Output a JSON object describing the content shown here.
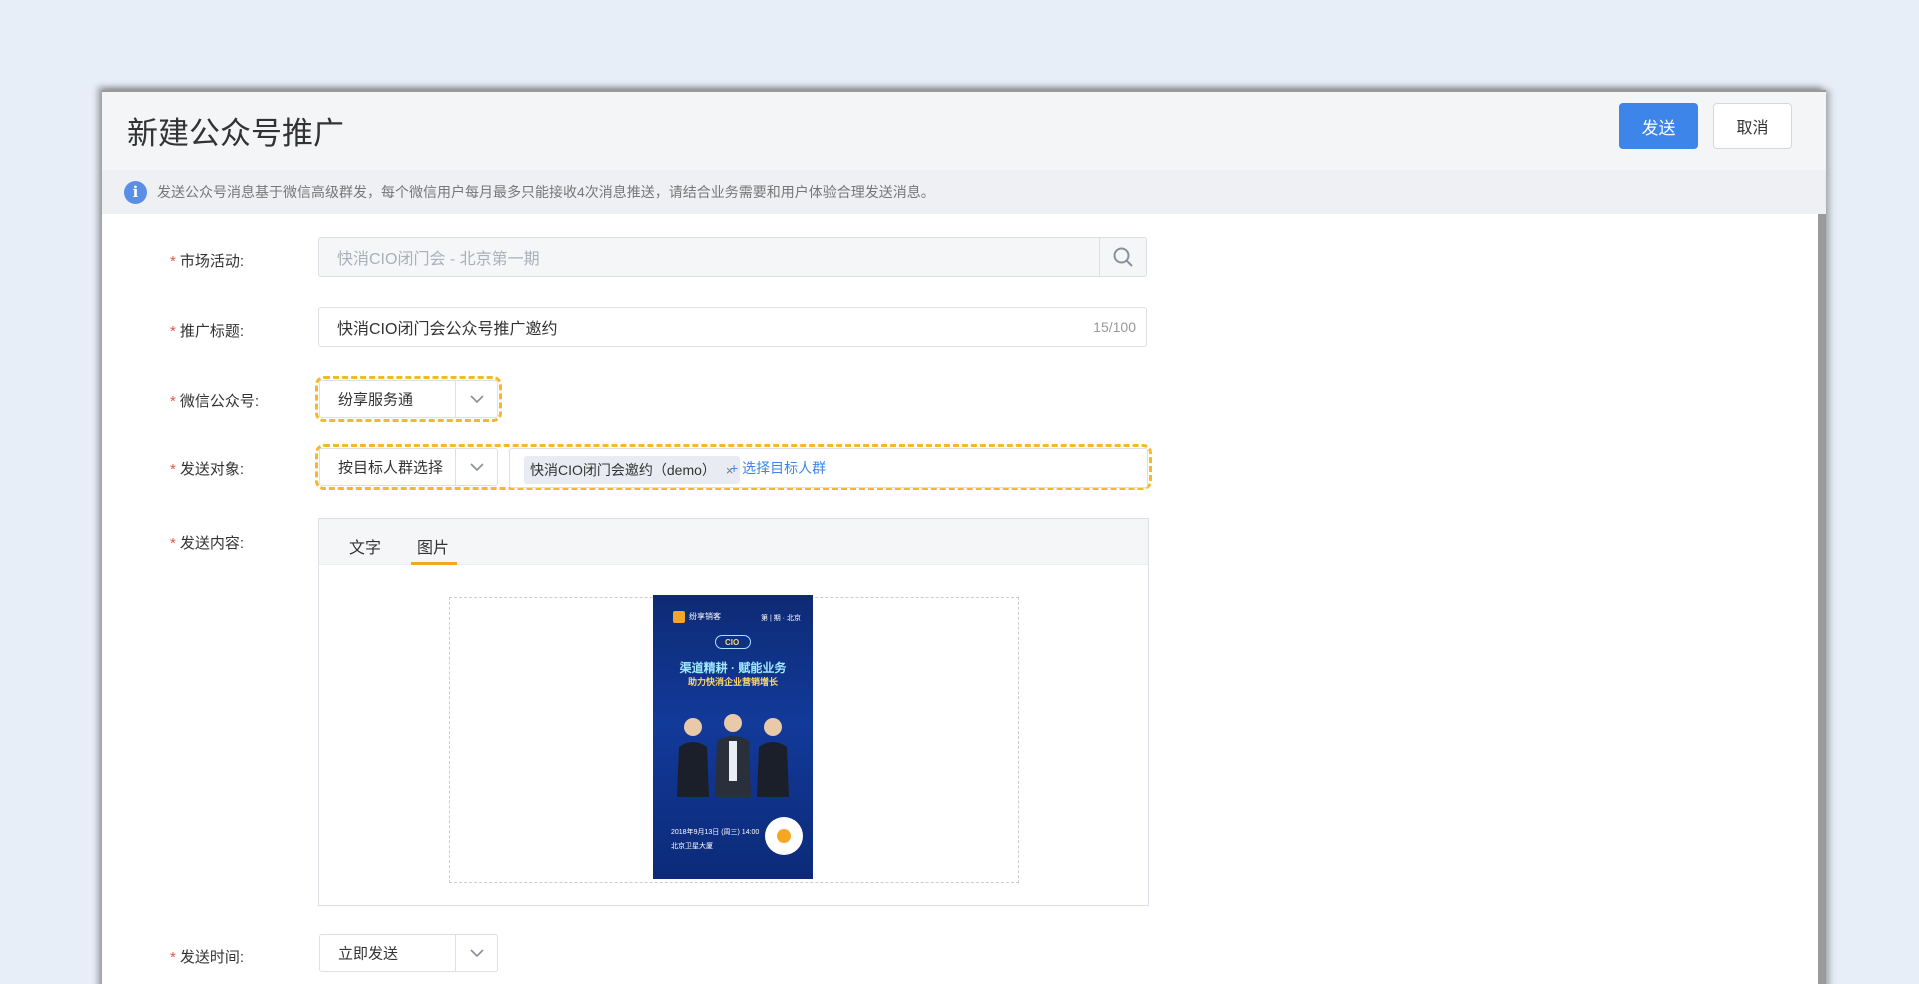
{
  "header": {
    "title": "新建公众号推广",
    "send_label": "发送",
    "cancel_label": "取消"
  },
  "notice": {
    "text": "发送公众号消息基于微信高级群发，每个微信用户每月最多只能接收4次消息推送，请结合业务需要和用户体验合理发送消息。"
  },
  "form": {
    "marketing_activity": {
      "label": "市场活动:",
      "value": "快消CIO闭门会 - 北京第一期"
    },
    "promo_title": {
      "label": "推广标题:",
      "value": "快消CIO闭门会公众号推广邀约",
      "counter": "15/100"
    },
    "wechat_account": {
      "label": "微信公众号:",
      "value": "纷享服务通"
    },
    "send_target": {
      "label": "发送对象:",
      "mode": "按目标人群选择",
      "tag": "快消CIO闭门会邀约（demo）",
      "tag_close": "×",
      "add_link": "+ 选择目标人群"
    },
    "send_content": {
      "label": "发送内容:",
      "tabs": [
        "文字",
        "图片"
      ],
      "active_tab": "图片"
    },
    "send_time": {
      "label": "发送时间:",
      "value": "立即发送"
    },
    "required_mark": "*"
  },
  "poster": {
    "brand": "纷享销客",
    "period": "第 | 期 · 北京",
    "badge": "CIO",
    "headline": "渠道精耕 · 赋能业务",
    "subline": "助力快消企业营销增长",
    "date": "2018年9月13日 (周三) 14:00",
    "venue": "北京卫星大厦"
  },
  "colors": {
    "primary": "#3d85e8",
    "highlight": "#f5b82a",
    "required": "#e2574c",
    "tab_active": "#f5a623"
  }
}
